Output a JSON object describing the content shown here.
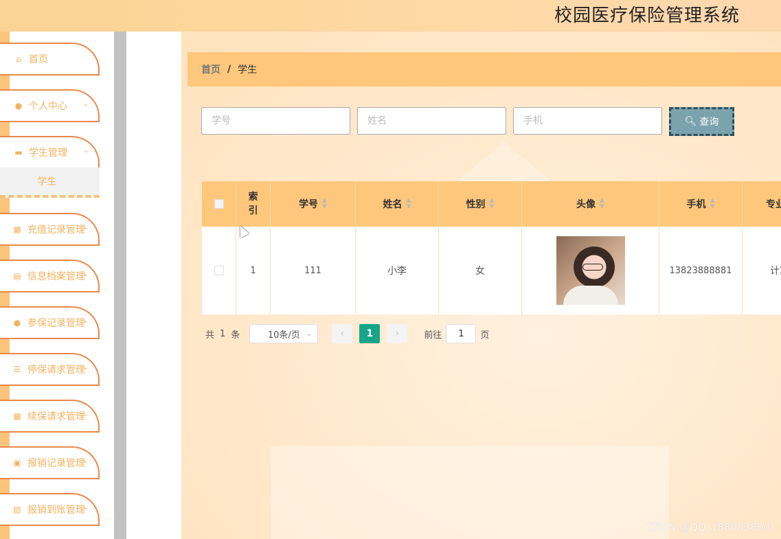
{
  "app": {
    "title": "校园医疗保险管理系统"
  },
  "sidebar": {
    "items": [
      {
        "label": "首页",
        "icon": "home-icon",
        "glyph": "⌂",
        "has_arrow": false
      },
      {
        "label": "个人中心",
        "icon": "user-icon",
        "glyph": "●",
        "has_arrow": true
      },
      {
        "label": "学生管理",
        "icon": "ticket-icon",
        "glyph": "▬",
        "has_arrow": true
      },
      {
        "label": "充值记录管理",
        "icon": "grid-icon",
        "glyph": "▦",
        "has_arrow": true
      },
      {
        "label": "信息档案管理",
        "icon": "book-icon",
        "glyph": "▤",
        "has_arrow": true
      },
      {
        "label": "参保记录管理",
        "icon": "user-icon",
        "glyph": "●",
        "has_arrow": true
      },
      {
        "label": "停保请求管理",
        "icon": "list-icon",
        "glyph": "☰",
        "has_arrow": true
      },
      {
        "label": "续保请求管理",
        "icon": "grid-icon",
        "glyph": "▦",
        "has_arrow": true
      },
      {
        "label": "报销记录管理",
        "icon": "clipboard-icon",
        "glyph": "▣",
        "has_arrow": true
      },
      {
        "label": "报销到账管理",
        "icon": "chart-icon",
        "glyph": "▧",
        "has_arrow": true
      }
    ],
    "submenu": {
      "label": "学生"
    }
  },
  "breadcrumb": {
    "home": "首页",
    "separator": "/",
    "current": "学生"
  },
  "search": {
    "student_id_placeholder": "学号",
    "name_placeholder": "姓名",
    "phone_placeholder": "手机",
    "query_label": "查询"
  },
  "table": {
    "headers": {
      "index": "索引",
      "student_id": "学号",
      "name": "姓名",
      "gender": "性别",
      "avatar": "头像",
      "phone": "手机",
      "major": "专业"
    },
    "rows": [
      {
        "index": "1",
        "student_id": "111",
        "name": "小李",
        "gender": "女",
        "phone": "13823888881",
        "major": "计算"
      }
    ]
  },
  "pager": {
    "total_prefix": "共",
    "total": "1",
    "total_suffix": "条",
    "page_size": "10条/页",
    "current_page": "1",
    "goto_prefix": "前往",
    "goto_value": "1",
    "goto_suffix": "页"
  },
  "watermark": "CSDN @QQ_188083800",
  "colors": {
    "accent": "#fec77b",
    "menu_border": "#e9884a",
    "menu_text": "#f2b35f",
    "active_page": "#17a589",
    "query_button": "#7aa3ad"
  }
}
